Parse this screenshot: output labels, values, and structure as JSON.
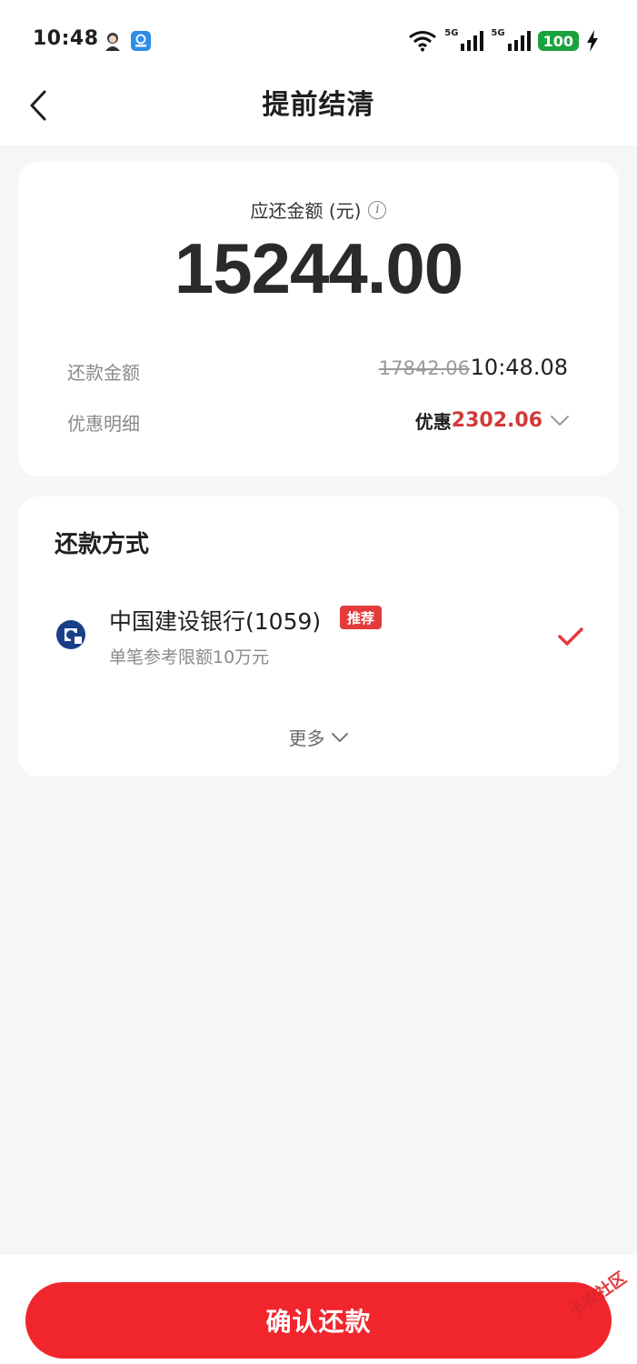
{
  "status_bar": {
    "time": "10:48",
    "network_1": "5G",
    "network_2": "5G",
    "battery": "100",
    "icons": [
      "avatar-icon",
      "app-icon",
      "wifi-icon",
      "signal-icon",
      "signal-icon",
      "battery-icon",
      "charging-icon"
    ]
  },
  "nav": {
    "title": "提前结清"
  },
  "amount_card": {
    "label": "应还金额 (元)",
    "info_icon_text": "i",
    "amount": "15244.00",
    "repay_row": {
      "label": "还款金额",
      "original": "17842.06",
      "value": "10:48.08"
    },
    "discount_row": {
      "label": "优惠明细",
      "prefix": "优惠",
      "amount": "2302.06"
    }
  },
  "method_card": {
    "title": "还款方式",
    "bank": {
      "name": "中国建设银行(1059)",
      "tag": "推荐",
      "desc": "单笔参考限额10万元",
      "selected": true
    },
    "more": "更多"
  },
  "confirm_button": "确认还款",
  "watermark": "卡农社区",
  "colors": {
    "accent": "#f0262c",
    "discount": "#d23a3a",
    "tag_bg": "#e33b3b",
    "bank_logo": "#1a3f8a"
  }
}
